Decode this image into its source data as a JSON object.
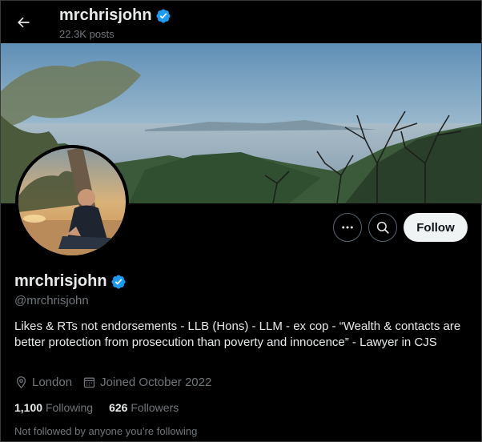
{
  "header": {
    "name": "mrchrisjohn",
    "posts": "22.3K posts"
  },
  "profile": {
    "display_name": "mrchrisjohn",
    "handle": "@mrchrisjohn",
    "verified": true,
    "bio": "Likes & RTs not endorsements - LLB (Hons) - LLM - ex cop - “Wealth & contacts are better protection from prosecution than poverty and innocence” - Lawyer in CJS",
    "location": "London",
    "joined": "Joined October 2022",
    "following_count": "1,100",
    "following_label": "Following",
    "followers_count": "626",
    "followers_label": "Followers",
    "not_followed": "Not followed by anyone you’re following"
  },
  "actions": {
    "follow_label": "Follow",
    "more_icon": "more-icon",
    "search_icon": "search-icon"
  },
  "colors": {
    "verified": "#1d9bf0",
    "background": "#000000",
    "follow_button_bg": "#eff3f4",
    "secondary_text": "#71767b"
  }
}
